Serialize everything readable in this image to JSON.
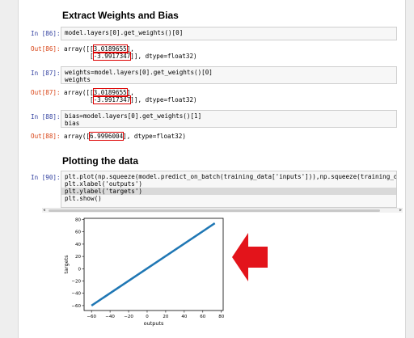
{
  "sections": {
    "weights_heading": "Extract Weights and Bias",
    "plot_heading": "Plotting the data"
  },
  "cells": [
    {
      "in_prompt": "In [86]:",
      "code": [
        "model.layers[0].get_weights()[0]"
      ],
      "out_prompt": "Out[86]:",
      "out_lines": [
        {
          "pre": "array([[",
          "hl": "3.0189655",
          "post": "],"
        },
        {
          "pre": "       [",
          "hl": "-3.9917347",
          "post": "]], dtype=float32)"
        }
      ]
    },
    {
      "in_prompt": "In [87]:",
      "code": [
        "weights=model.layers[0].get_weights()[0]",
        "weights"
      ],
      "out_prompt": "Out[87]:",
      "out_lines": [
        {
          "pre": "array([[",
          "hl": "3.0189655",
          "post": "],"
        },
        {
          "pre": "       [",
          "hl": "-3.9917347",
          "post": "]], dtype=float32)"
        }
      ]
    },
    {
      "in_prompt": "In [88]:",
      "code": [
        "bias=model.layers[0].get_weights()[1]",
        "bias"
      ],
      "out_prompt": "Out[88]:",
      "out_lines": [
        {
          "pre": "array([",
          "hl": "6.9996004",
          "post": "], dtype=float32)"
        }
      ]
    },
    {
      "in_prompt": "In [90]:",
      "code": [
        "plt.plot(np.squeeze(model.predict_on_batch(training_data['inputs'])),np.squeeze(training_data['targets",
        "plt.xlabel('outputs')",
        "plt.ylabel('targets')",
        "plt.show()"
      ]
    }
  ],
  "chart_data": {
    "type": "line",
    "x": [
      -60,
      73
    ],
    "y": [
      -60,
      74
    ],
    "xlim": [
      -68,
      82
    ],
    "ylim": [
      -68,
      82
    ],
    "xticks": [
      -60,
      -40,
      -20,
      0,
      20,
      40,
      60,
      80
    ],
    "yticks": [
      -60,
      -40,
      -20,
      0,
      20,
      40,
      60,
      80
    ],
    "xlabel": "outputs",
    "ylabel": "targets",
    "line_color": "#1f77b4",
    "grid": false
  },
  "annotation": {
    "arrow_color": "#e3141b",
    "arrow_direction": "left"
  }
}
